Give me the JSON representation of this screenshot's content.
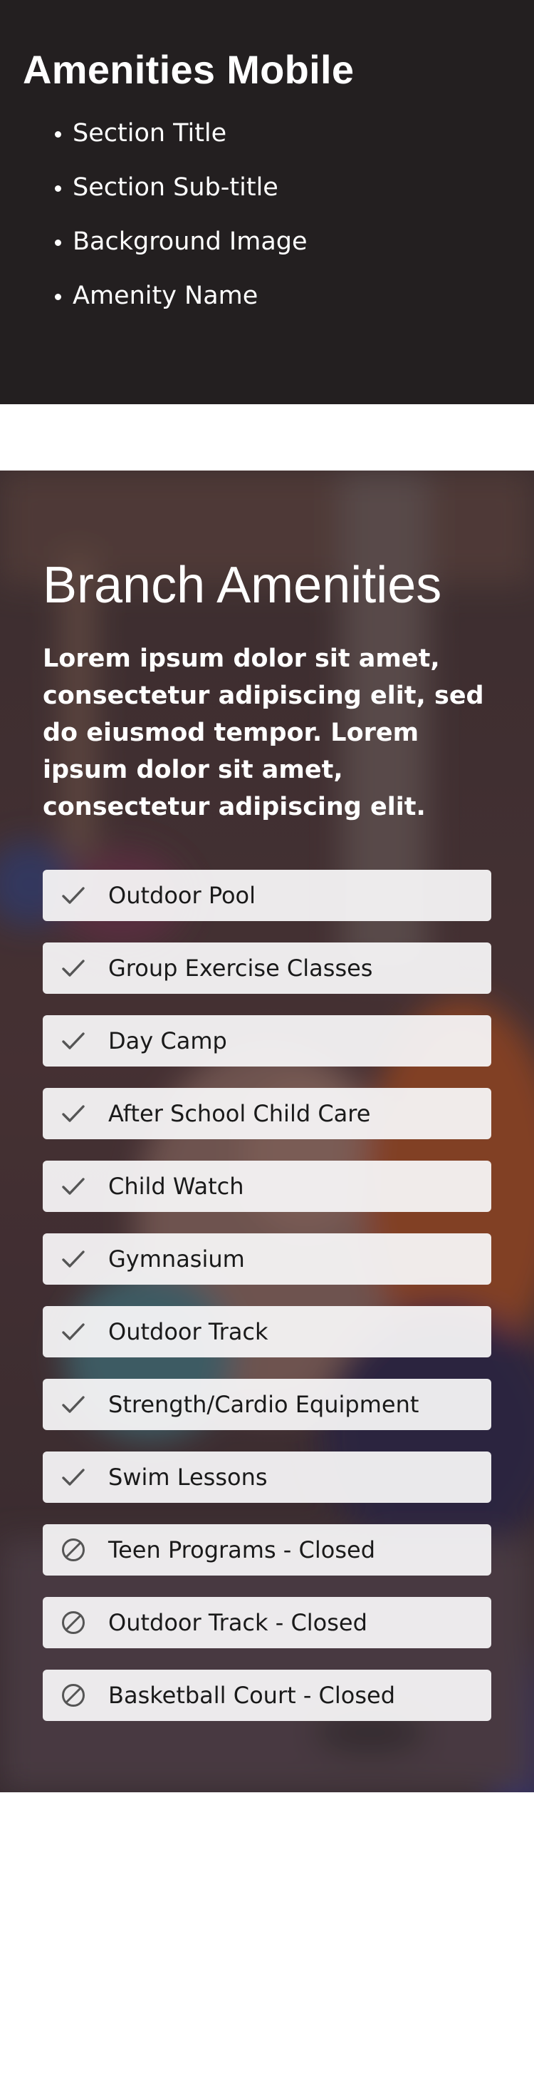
{
  "spec": {
    "title": "Amenities Mobile",
    "items": [
      "Section Title",
      "Section Sub-title",
      "Background Image",
      "Amenity Name"
    ]
  },
  "amenities": {
    "title": "Branch Amenities",
    "subtitle": "Lorem ipsum dolor sit amet, consectetur adipiscing elit, sed do eiusmod tempor. Lorem ipsum dolor sit amet, consectetur adipiscing elit.",
    "items": [
      {
        "label": "Outdoor Pool",
        "status": "available",
        "icon": "check-icon"
      },
      {
        "label": "Group Exercise Classes",
        "status": "available",
        "icon": "check-icon"
      },
      {
        "label": "Day Camp",
        "status": "available",
        "icon": "check-icon"
      },
      {
        "label": "After School Child Care",
        "status": "available",
        "icon": "check-icon"
      },
      {
        "label": "Child Watch",
        "status": "available",
        "icon": "check-icon"
      },
      {
        "label": "Gymnasium",
        "status": "available",
        "icon": "check-icon"
      },
      {
        "label": "Outdoor Track",
        "status": "available",
        "icon": "check-icon"
      },
      {
        "label": "Strength/Cardio Equipment",
        "status": "available",
        "icon": "check-icon"
      },
      {
        "label": "Swim Lessons",
        "status": "available",
        "icon": "check-icon"
      },
      {
        "label": "Teen Programs - Closed",
        "status": "closed",
        "icon": "closed-icon"
      },
      {
        "label": "Outdoor Track - Closed",
        "status": "closed",
        "icon": "closed-icon"
      },
      {
        "label": "Basketball Court - Closed",
        "status": "closed",
        "icon": "closed-icon"
      }
    ]
  },
  "colors": {
    "header_bg": "#231f20",
    "item_bg": "#f6f5f6",
    "icon": "#555555"
  }
}
